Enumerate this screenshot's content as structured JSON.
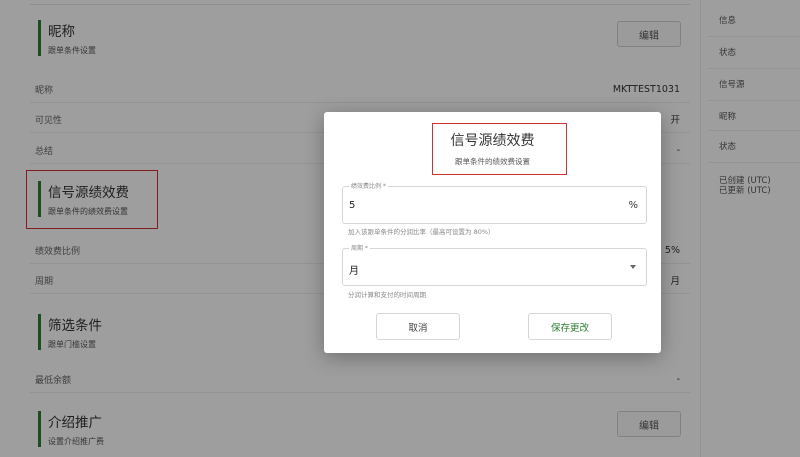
{
  "main": {
    "nickname_section": {
      "title": "昵称",
      "subtitle": "跟单条件设置",
      "edit_label": "编辑"
    },
    "nickname_rows": [
      {
        "key": "昵称",
        "value": "MKTTEST1031"
      },
      {
        "key": "可见性",
        "value": "开"
      },
      {
        "key": "总结",
        "value": "-"
      }
    ],
    "fee_section": {
      "title": "信号源绩效费",
      "subtitle": "跟单条件的绩效费设置"
    },
    "fee_rows": [
      {
        "key": "绩效费比例",
        "value": "5%"
      },
      {
        "key": "周期",
        "value": "月"
      }
    ],
    "filter_section": {
      "title": "筛选条件",
      "subtitle": "跟单门槛设置"
    },
    "filter_rows": [
      {
        "key": "最低余额",
        "value": "-"
      }
    ],
    "promo_section": {
      "title": "介绍推广",
      "subtitle": "设置介绍推广费",
      "edit_label": "编辑"
    }
  },
  "sidebar": {
    "items": [
      {
        "label": "信息"
      },
      {
        "label": "状态"
      },
      {
        "label": "信号源"
      },
      {
        "label": "昵称"
      },
      {
        "label": "状态"
      },
      {
        "label": "已创建 (UTC)"
      },
      {
        "label": "已更新 (UTC)"
      }
    ]
  },
  "dialog": {
    "title": "信号源绩效费",
    "subtitle": "跟单条件的绩效费设置",
    "ratio_field": {
      "label": "绩效费比例 *",
      "value": "5",
      "unit": "%",
      "hint": "加入该跟单条件的分润比率（最高可设置为 80%）"
    },
    "period_field": {
      "label": "周期 *",
      "value": "月",
      "hint": "分润计算和支付的时间周期"
    },
    "cancel_label": "取消",
    "save_label": "保存更改"
  },
  "colors": {
    "accent": "#2e7d32",
    "highlight_box": "#d32f2f"
  }
}
